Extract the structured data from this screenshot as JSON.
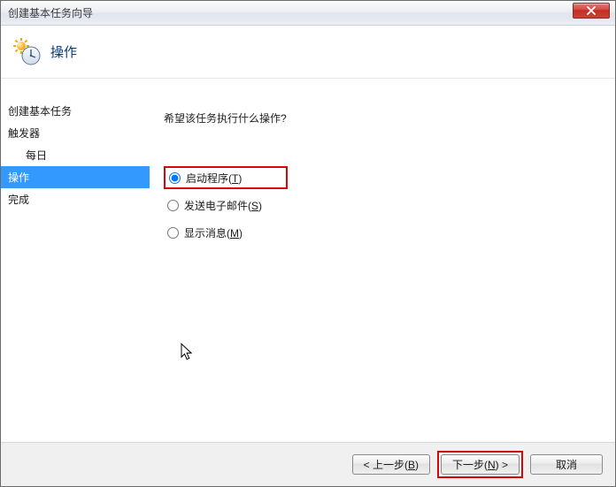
{
  "titlebar": {
    "title": "创建基本任务向导"
  },
  "header": {
    "title": "操作"
  },
  "sidebar": {
    "items": [
      {
        "label": "创建基本任务"
      },
      {
        "label": "触发器"
      },
      {
        "label": "每日"
      },
      {
        "label": "操作"
      },
      {
        "label": "完成"
      }
    ]
  },
  "content": {
    "prompt": "希望该任务执行什么操作?",
    "options": [
      {
        "label_pre": "启动程序(",
        "accel": "T",
        "label_post": ")"
      },
      {
        "label_pre": "发送电子邮件(",
        "accel": "S",
        "label_post": ")"
      },
      {
        "label_pre": "显示消息(",
        "accel": "M",
        "label_post": ")"
      }
    ]
  },
  "footer": {
    "back_pre": "< 上一步(",
    "back_accel": "B",
    "back_post": ")",
    "next_pre": "下一步(",
    "next_accel": "N",
    "next_post": ") >",
    "cancel": "取消"
  }
}
